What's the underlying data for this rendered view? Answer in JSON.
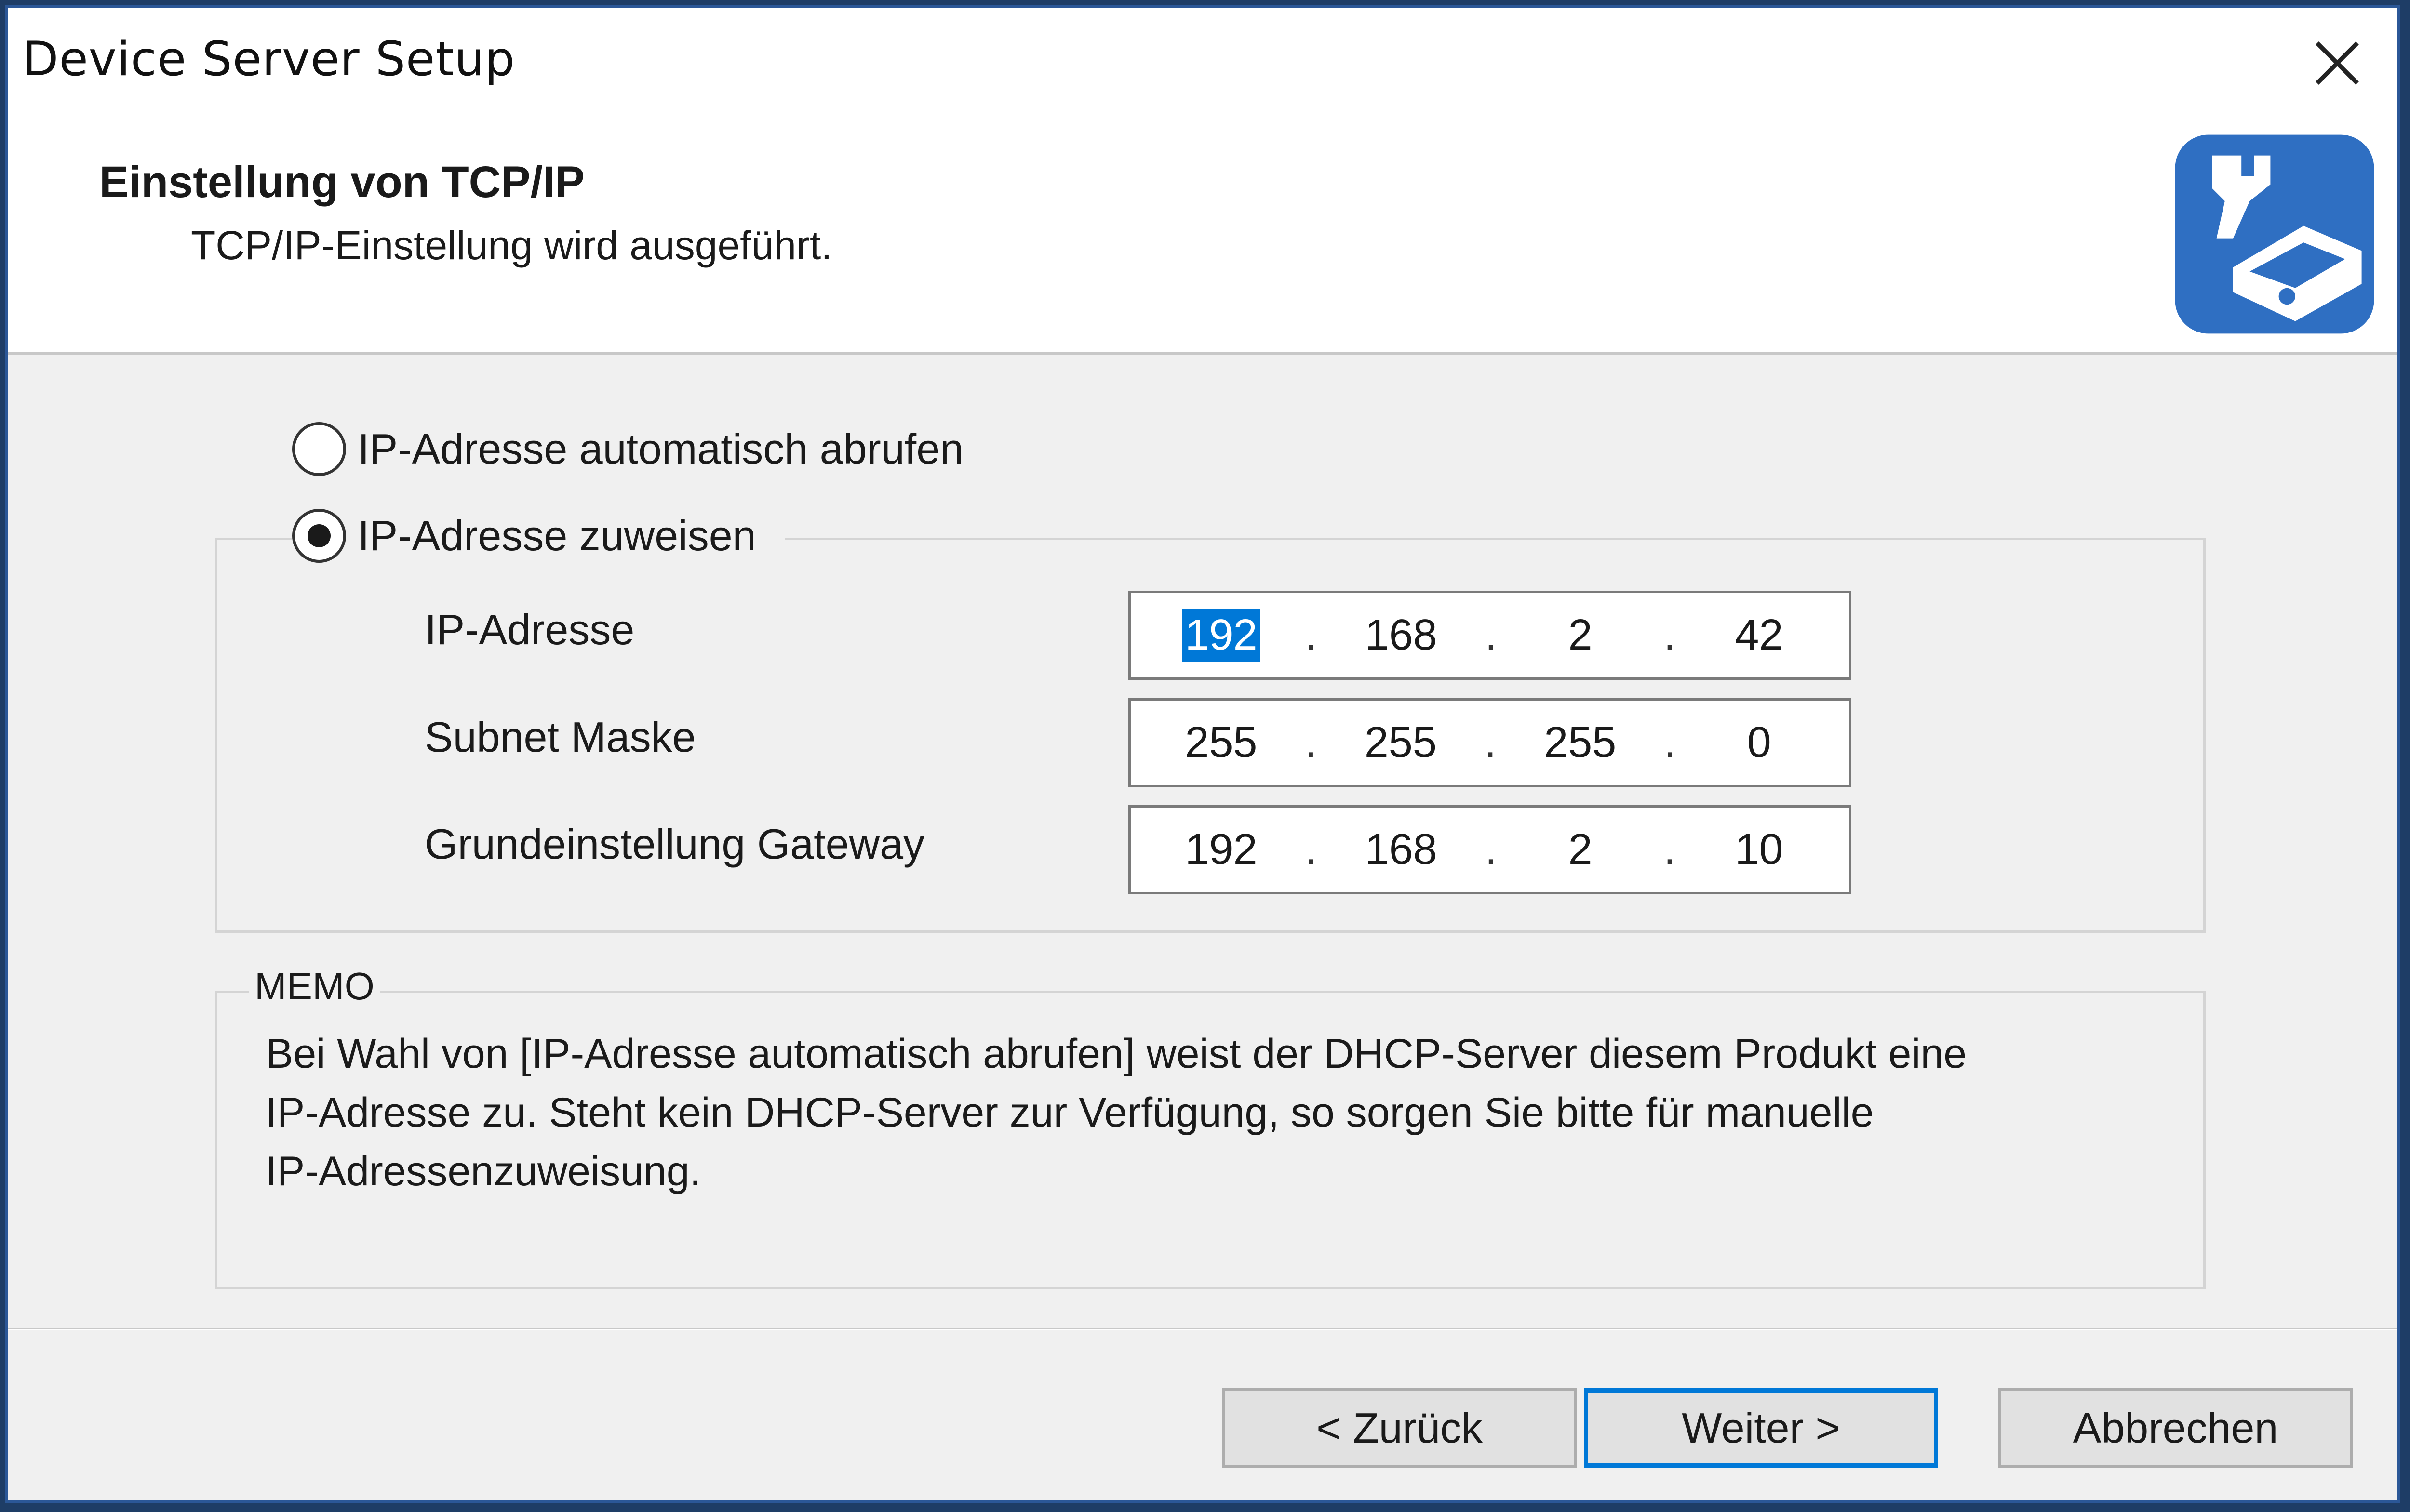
{
  "window": {
    "title": "Device Server Setup"
  },
  "header": {
    "title": "Einstellung von TCP/IP",
    "subtitle": "TCP/IP-Einstellung wird ausgeführt."
  },
  "options": {
    "auto_label": "IP-Adresse automatisch abrufen",
    "manual_label": "IP-Adresse zuweisen",
    "selected": "manual"
  },
  "fields": [
    {
      "label": "IP-Adresse",
      "octets": [
        "192",
        "168",
        "2",
        "42"
      ]
    },
    {
      "label": "Subnet Maske",
      "octets": [
        "255",
        "255",
        "255",
        "0"
      ]
    },
    {
      "label": "Grundeinstellung Gateway",
      "octets": [
        "192",
        "168",
        "2",
        "10"
      ]
    }
  ],
  "memo": {
    "legend": "MEMO",
    "line1": "Bei Wahl von [IP-Adresse automatisch abrufen] weist der DHCP-Server diesem Produkt eine",
    "line2": "IP-Adresse zu. Steht kein DHCP-Server zur Verfügung, so sorgen Sie bitte für manuelle",
    "line3": "IP-Adressenzuweisung."
  },
  "buttons": {
    "back": "< Zurück",
    "next": "Weiter >",
    "cancel": "Abbrechen"
  },
  "icons": {
    "close": "close-icon",
    "logo": "wrench-device-icon"
  },
  "colors": {
    "accent": "#0078d7",
    "logo_blue": "#2f6fc2",
    "window_border": "#2b5797"
  }
}
